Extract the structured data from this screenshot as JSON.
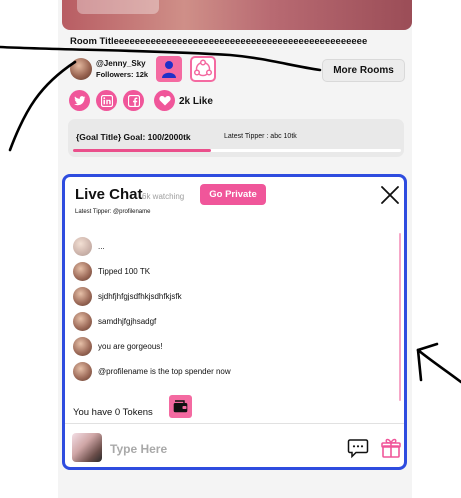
{
  "room": {
    "title": "Room Titleeeeeeeeeeeeeeeeeeeeeeeeeeeeeeeeeeeeeeeeeeeeeeee"
  },
  "streamer": {
    "name": "@Jenny_Sky",
    "followers": "Followers: 12k"
  },
  "actions": {
    "more_rooms": "More Rooms"
  },
  "social": {
    "likes": "2k Like"
  },
  "goal": {
    "label": "{Goal Title} Goal: 100/2000tk",
    "latest_tipper": "Latest Tipper : abc 10tk",
    "progress": 0.42
  },
  "chat": {
    "title": "Live Chat",
    "watching": "6k watching",
    "go_private": "Go Private",
    "latest_tipper": "Latest Tipper: @profilename",
    "messages": [
      {
        "text": "..."
      },
      {
        "text": "Tipped 100 TK"
      },
      {
        "text": "sjdhfjhfgjsdfhkjsdhfkjsfk"
      },
      {
        "text": "samdhjfgjhsadgf"
      },
      {
        "text": "you are gorgeous!"
      },
      {
        "text": "@profilename is the top spender now"
      }
    ],
    "tokens": "You have 0 Tokens",
    "input_placeholder": "Type Here"
  },
  "colors": {
    "accent_pink": "#f0569a",
    "chat_border_blue": "#2e4cdf"
  }
}
